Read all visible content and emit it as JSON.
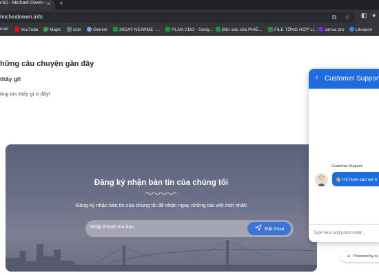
{
  "browser": {
    "tab_title": "chủ - Michael Owen - ...",
    "tab_close": "×",
    "new_tab": "+",
    "url": "michealowen.info",
    "bookmarks": [
      {
        "label": "mail",
        "color": "#e04b3a"
      },
      {
        "label": "YouTube",
        "color": "#ff0000"
      },
      {
        "label": "Maps",
        "color": "#34a853"
      },
      {
        "label": "ison",
        "color": "#4a8a6a"
      },
      {
        "label": "Gemini",
        "color": "#7aa7f0"
      },
      {
        "label": "30DAY NEARME -...",
        "color": "#1f8f3a"
      },
      {
        "label": "PLAN CDO - Goog...",
        "color": "#1f8f3a"
      },
      {
        "label": "Bản sao của PHIẾ...",
        "color": "#1f8f3a"
      },
      {
        "label": "FILE TỔNG HỢP LI...",
        "color": "#1f8f3a"
      },
      {
        "label": "canva pro",
        "color": "#7d2ae8"
      },
      {
        "label": "Likepion",
        "color": "#3b82f6"
      }
    ]
  },
  "page": {
    "heading": "hững câu chuyện gần đây",
    "subheading": "thấy gì!",
    "body_text": "ông tìm thấy gì ở đây!"
  },
  "newsletter": {
    "title": "Đăng ký nhận bản tin của chúng tôi",
    "description": "Đăng ký nhận bản tin của chúng tôi để nhận ngay những bài viết mới nhất!",
    "email_placeholder": "Nhập Email của bạn",
    "subscribe_label": "Đặt mua"
  },
  "chat": {
    "title": "Customer Support",
    "back_icon": "‹",
    "sender": "Customer Support",
    "message": "👋 Hi! How can we h",
    "input_placeholder": "Type here and press enter..",
    "powered_by": "Powered by ta"
  },
  "colors": {
    "chrome_dark": "#35363a",
    "accent_blue": "#1f6be0",
    "subscribe_blue": "#3b73d9"
  }
}
